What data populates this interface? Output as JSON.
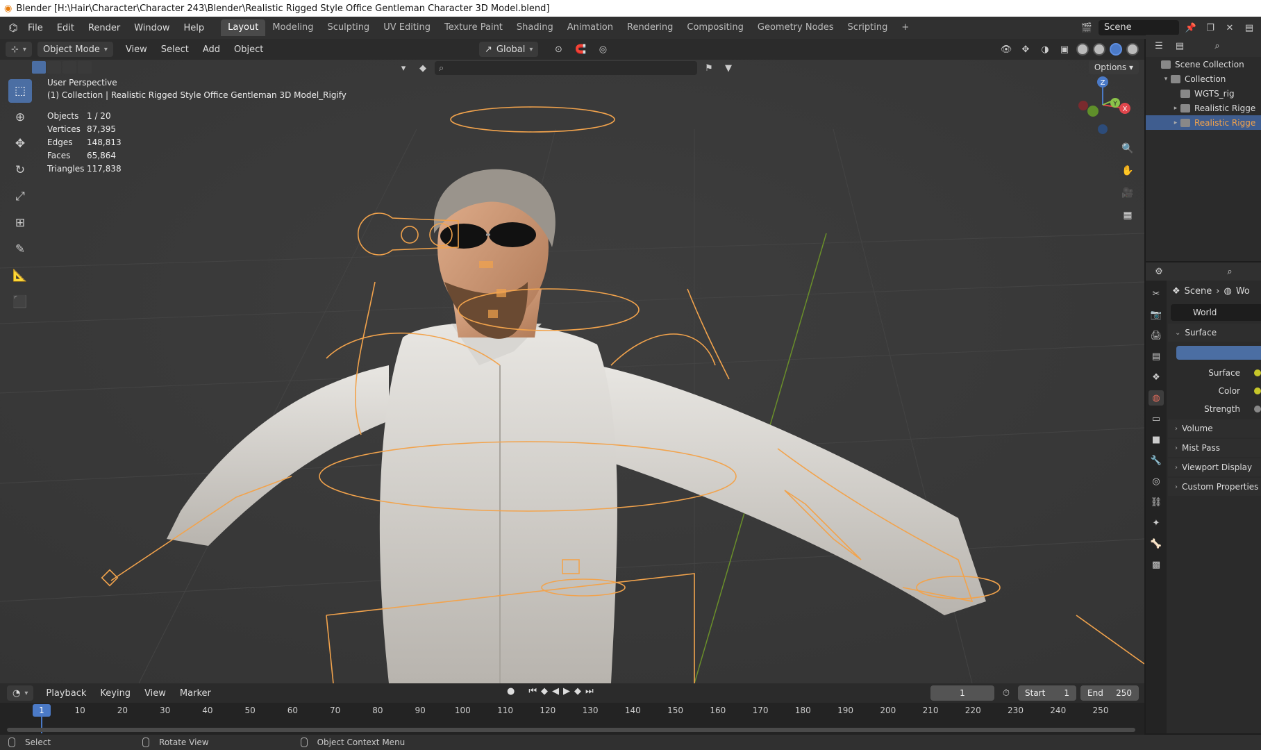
{
  "window": {
    "title": "Blender [H:\\Hair\\Character\\Character 243\\Blender\\Realistic Rigged Style Office Gentleman Character 3D Model.blend]"
  },
  "topbar": {
    "menu": [
      "File",
      "Edit",
      "Render",
      "Window",
      "Help"
    ],
    "workspaces": [
      "Layout",
      "Modeling",
      "Sculpting",
      "UV Editing",
      "Texture Paint",
      "Shading",
      "Animation",
      "Rendering",
      "Compositing",
      "Geometry Nodes",
      "Scripting"
    ],
    "active_workspace": "Layout",
    "add_label": "+",
    "scene_name": "Scene"
  },
  "viewport_header": {
    "mode": "Object Mode",
    "menu": [
      "View",
      "Select",
      "Add",
      "Object"
    ],
    "orientation": "Global",
    "options": "Options"
  },
  "viewport": {
    "perspective": "User Perspective",
    "collection_info": "(1) Collection | Realistic Rigged Style Office Gentleman 3D Model_Rigify",
    "stats": [
      {
        "key": "Objects",
        "value": "1 / 20"
      },
      {
        "key": "Vertices",
        "value": "87,395"
      },
      {
        "key": "Edges",
        "value": "148,813"
      },
      {
        "key": "Faces",
        "value": "65,864"
      },
      {
        "key": "Triangles",
        "value": "117,838"
      }
    ],
    "gizmo": {
      "z": "Z",
      "y": "Y",
      "x": "X"
    }
  },
  "outliner": {
    "rows": [
      {
        "label": "Scene Collection",
        "indent": 0,
        "selected": false,
        "expander": ""
      },
      {
        "label": "Collection",
        "indent": 1,
        "selected": false,
        "expander": "▾"
      },
      {
        "label": "WGTS_rig",
        "indent": 2,
        "selected": false,
        "expander": ""
      },
      {
        "label": "Realistic Rigge",
        "indent": 2,
        "selected": false,
        "expander": "▸"
      },
      {
        "label": "Realistic Rigge",
        "indent": 2,
        "selected": true,
        "expander": "▸"
      }
    ]
  },
  "properties": {
    "breadcrumb_scene": "Scene",
    "breadcrumb_world": "Wo",
    "world_name": "World",
    "panels": {
      "surface": "Surface",
      "surface_field": "Surface",
      "color": "Color",
      "strength": "Strength",
      "volume": "Volume",
      "mist": "Mist Pass",
      "viewport_display": "Viewport Display",
      "custom": "Custom Properties"
    },
    "accent": "#4b6ea3"
  },
  "timeline": {
    "menu": [
      "Playback",
      "Keying",
      "View",
      "Marker"
    ],
    "current_frame": "1",
    "start_label": "Start",
    "start": "1",
    "end_label": "End",
    "end": "250",
    "ticks": [
      "10",
      "20",
      "30",
      "40",
      "50",
      "60",
      "70",
      "80",
      "90",
      "100",
      "110",
      "120",
      "130",
      "140",
      "150",
      "160",
      "170",
      "180",
      "190",
      "200",
      "210",
      "220",
      "230",
      "240",
      "250"
    ],
    "playhead_frame": "1"
  },
  "statusbar": {
    "select": "Select",
    "rotate": "Rotate View",
    "context": "Object Context Menu"
  }
}
